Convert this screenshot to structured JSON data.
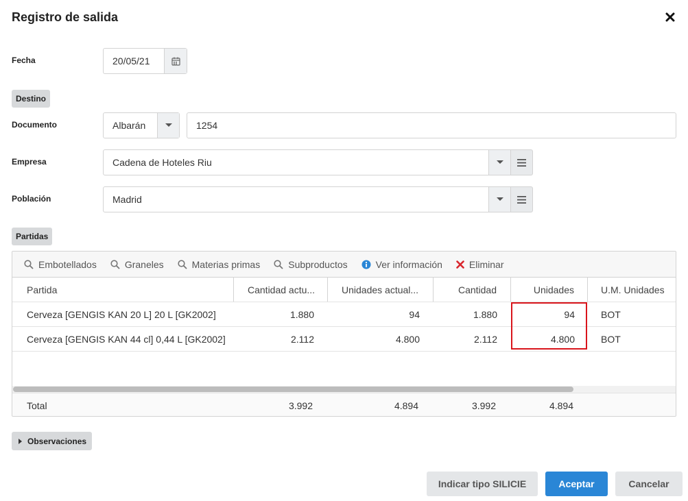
{
  "dialog": {
    "title": "Registro de salida"
  },
  "fecha": {
    "label": "Fecha",
    "value": "20/05/21"
  },
  "destino": {
    "label": "Destino"
  },
  "documento": {
    "label": "Documento",
    "type_value": "Albarán",
    "number_value": "1254"
  },
  "empresa": {
    "label": "Empresa",
    "value": "Cadena de Hoteles Riu"
  },
  "poblacion": {
    "label": "Población",
    "value": "Madrid"
  },
  "partidas": {
    "label": "Partidas",
    "toolbar": {
      "embotellados": "Embotellados",
      "graneles": "Graneles",
      "materias_primas": "Materias primas",
      "subproductos": "Subproductos",
      "ver_informacion": "Ver información",
      "eliminar": "Eliminar"
    },
    "columns": [
      "Partida",
      "Cantidad actu...",
      "Unidades actual...",
      "Cantidad",
      "Unidades",
      "U.M. Unidades"
    ],
    "rows": [
      [
        "Cerveza [GENGIS KAN 20 L] 20 L [GK2002]",
        "1.880",
        "94",
        "1.880",
        "94",
        "BOT"
      ],
      [
        "Cerveza [GENGIS KAN 44 cl] 0,44 L [GK2002]",
        "2.112",
        "4.800",
        "2.112",
        "4.800",
        "BOT"
      ]
    ],
    "totals": [
      "Total",
      "3.992",
      "4.894",
      "3.992",
      "4.894",
      ""
    ]
  },
  "observaciones": {
    "label": "Observaciones"
  },
  "buttons": {
    "silicie": "Indicar tipo SILICIE",
    "aceptar": "Aceptar",
    "cancelar": "Cancelar"
  },
  "colors": {
    "accent": "#2a86d6",
    "highlight": "#d9141b",
    "delete": "#d9272e",
    "info": "#2a86d6"
  }
}
